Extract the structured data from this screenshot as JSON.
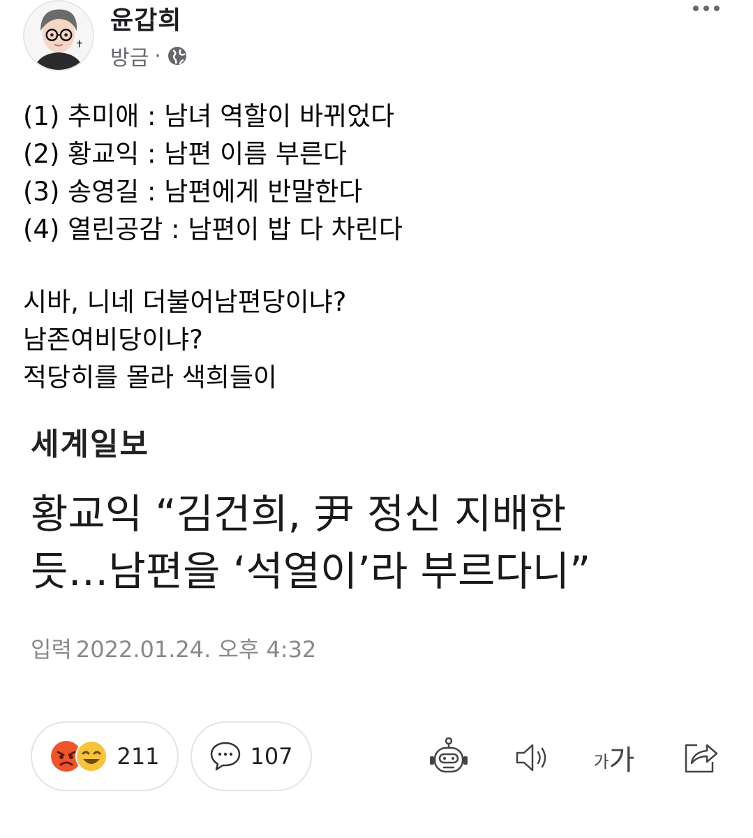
{
  "post": {
    "author": "윤갑희",
    "time": "방금",
    "separator": "·",
    "lines_a": [
      "(1) 추미애 : 남녀 역할이 바뀌었다",
      "(2) 황교익 : 남편 이름 부른다",
      "(3) 송영길 : 남편에게 반말한다",
      "(4) 열린공감 : 남편이 밥 다 차린다"
    ],
    "lines_b": [
      "시바, 니네 더불어남편당이냐?",
      "남존여비당이냐?",
      "적당히를 몰라 색희들이"
    ]
  },
  "article": {
    "publisher": "세계일보",
    "headline_line1": "황교익 “김건희, 尹 정신 지배한",
    "headline_line2": "듯…남편을 ‘석열이’라 부르다니”",
    "timestamp_label": "입력",
    "timestamp_value": "2022.01.24. 오후 4:32"
  },
  "actions": {
    "reaction_count": "211",
    "comment_count": "107",
    "font_size_small": "가",
    "font_size_large": "가"
  },
  "icons": {
    "avatar": "avatar-cartoon",
    "globe": "globe-icon",
    "more": "more-dots-icon",
    "reaction_angry": "angry-reaction-icon",
    "reaction_haha": "laugh-reaction-icon",
    "comment": "speech-bubble-icon",
    "bot": "robot-icon",
    "speaker": "speaker-icon",
    "share": "share-icon"
  },
  "colors": {
    "angry": "#f0552a",
    "haha": "#f7c33b",
    "muted_text": "#65676b"
  }
}
